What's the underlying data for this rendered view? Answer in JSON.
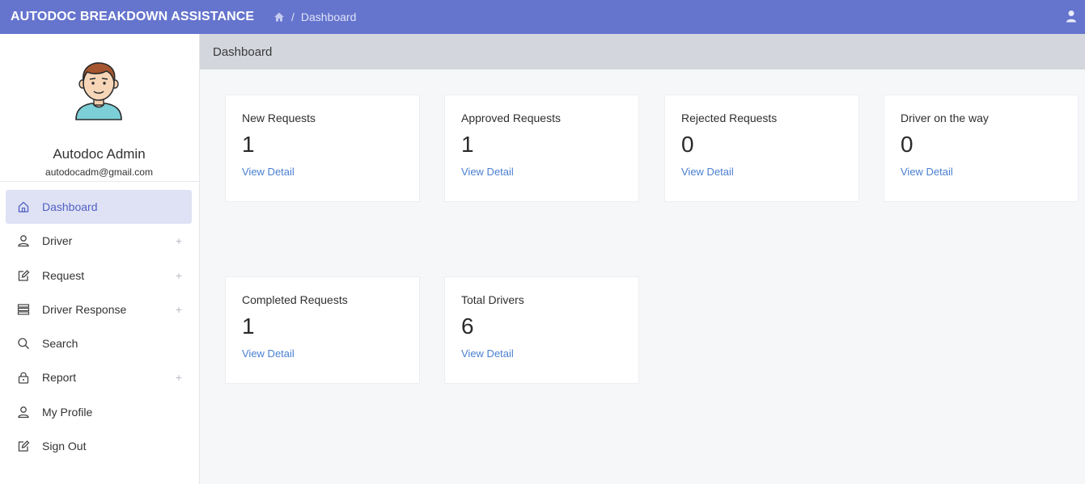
{
  "app": {
    "title": "AUTODOC BREAKDOWN ASSISTANCE"
  },
  "breadcrumb": {
    "separator": "/",
    "current": "Dashboard"
  },
  "topbar": {
    "user_icon": "user-icon",
    "home_icon": "home-icon"
  },
  "colors": {
    "topbar": "#6574cd",
    "active_bg": "#dfe2f4",
    "link": "#4a7fd1",
    "header_bar": "#d3d6dc"
  },
  "profile": {
    "name": "Autodoc Admin",
    "email": "autodocadm@gmail.com"
  },
  "sidebar": {
    "items": [
      {
        "label": "Dashboard",
        "icon": "home-icon",
        "expandable": false,
        "active": true
      },
      {
        "label": "Driver",
        "icon": "user-icon",
        "expandable": true
      },
      {
        "label": "Request",
        "icon": "edit-icon",
        "expandable": true
      },
      {
        "label": "Driver Response",
        "icon": "list-icon",
        "expandable": true
      },
      {
        "label": "Search",
        "icon": "search-icon",
        "expandable": false
      },
      {
        "label": "Report",
        "icon": "lock-icon",
        "expandable": true
      },
      {
        "label": "My Profile",
        "icon": "user-icon",
        "expandable": false
      },
      {
        "label": "Sign Out",
        "icon": "edit-icon",
        "expandable": false
      }
    ],
    "expand_symbol": "+"
  },
  "main": {
    "header": "Dashboard"
  },
  "cards": [
    {
      "title": "New Requests",
      "value": "1",
      "link": "View Detail"
    },
    {
      "title": "Approved Requests",
      "value": "1",
      "link": "View Detail"
    },
    {
      "title": "Rejected Requests",
      "value": "0",
      "link": "View Detail"
    },
    {
      "title": "Driver on the way",
      "value": "0",
      "link": "View Detail"
    },
    {
      "title": "Completed Requests",
      "value": "1",
      "link": "View Detail"
    },
    {
      "title": "Total Drivers",
      "value": "6",
      "link": "View Detail"
    }
  ]
}
